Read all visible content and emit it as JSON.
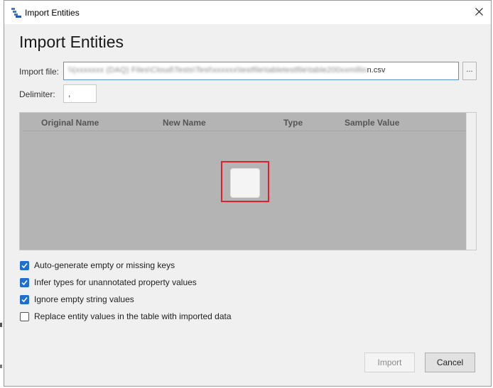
{
  "window": {
    "title": "Import Entities",
    "app_icon": "table-app-icon",
    "close_icon": "close-icon"
  },
  "heading": "Import Entities",
  "import_file": {
    "label": "Import file:",
    "value_visible_suffix": "n.csv",
    "value_obscured": "\\\\(xxxxxxx (DAQ) Files\\Cloud\\Tests\\Test\\xxxxxx\\testfile\\tabletestfile\\table200xxmillio",
    "browse_label": "..."
  },
  "delimiter": {
    "label": "Delimiter:",
    "value": ","
  },
  "grid": {
    "columns": [
      "Original Name",
      "New Name",
      "Type",
      "Sample Value"
    ],
    "loading": true
  },
  "options": [
    {
      "label": "Auto-generate empty or missing keys",
      "checked": true
    },
    {
      "label": "Infer types for unannotated property values",
      "checked": true
    },
    {
      "label": "Ignore empty string values",
      "checked": true
    },
    {
      "label": "Replace entity values in the table with imported data",
      "checked": false
    }
  ],
  "buttons": {
    "import": "Import",
    "cancel": "Cancel"
  },
  "colors": {
    "accent": "#1f6fd1",
    "highlight": "#e0202a",
    "grid_bg": "#b4b4b4"
  }
}
